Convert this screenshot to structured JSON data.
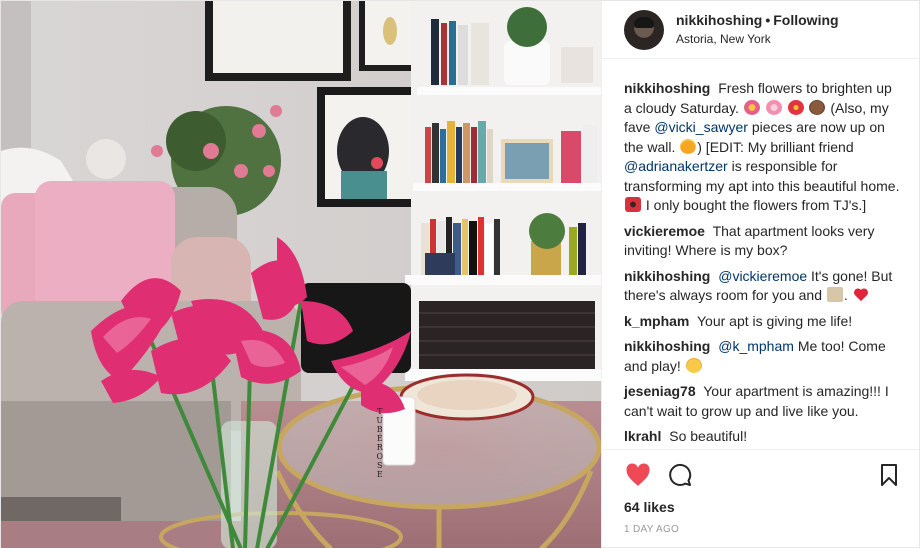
{
  "post": {
    "username": "nikkihoshing",
    "separator": "•",
    "follow_status": "Following",
    "location": "Astoria, New York",
    "avatar_icon": "profile-avatar",
    "photo_candle_label": "TUBÉ ROSE",
    "caption": {
      "user": "nikkihoshing",
      "part1": "Fresh flowers to brighten up a cloudy Saturday.",
      "part2": "(Also, my fave",
      "mention1": "@vicki_sawyer",
      "part3": "pieces are now up on the wall.",
      "part4": ") [EDIT: My brilliant friend",
      "mention2": "@adrianakertzer",
      "part5": "is responsible for transforming my apt into this beautiful home.",
      "part6": "I only bought the flowers from TJ's.]"
    },
    "comments": [
      {
        "user": "vickieremoe",
        "text": "That apartment looks very inviting! Where is my box?"
      },
      {
        "user": "nikkihoshing",
        "mention": "@vickieremoe",
        "text": "It's gone! But there's always room for you and"
      },
      {
        "user": "k_mpham",
        "text": "Your apt is giving me life!"
      },
      {
        "user": "nikkihoshing",
        "mention": "@k_mpham",
        "text": "Me too! Come and play!"
      },
      {
        "user": "jeseniag78",
        "text": "Your apartment is amazing!!! I can't wait to grow up and live like you."
      },
      {
        "user": "lkrahl",
        "text": "So beautiful!"
      }
    ],
    "likes": "64 likes",
    "timestamp": "1 DAY AGO",
    "icons": {
      "like": "heart-icon",
      "comment": "comment-bubble-icon",
      "save": "bookmark-icon"
    },
    "colors": {
      "like_active": "#ed4956",
      "mention": "#003569",
      "muted": "#999999",
      "text": "#262626"
    }
  }
}
